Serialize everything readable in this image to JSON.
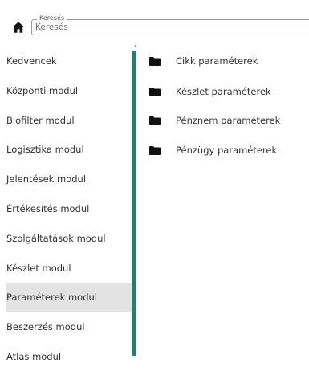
{
  "search": {
    "label": "Keresés",
    "placeholder": "Keresés"
  },
  "sidebar": {
    "items": [
      {
        "label": "Kedvencek",
        "selected": false
      },
      {
        "label": "Központi modul",
        "selected": false
      },
      {
        "label": "Biofilter modul",
        "selected": false
      },
      {
        "label": "Logisztika modul",
        "selected": false
      },
      {
        "label": "Jelentések modul",
        "selected": false
      },
      {
        "label": "Értékesítés modul",
        "selected": false
      },
      {
        "label": "Szolgáltatások modul",
        "selected": false
      },
      {
        "label": "Készlet modul",
        "selected": false
      },
      {
        "label": "Paraméterek modul",
        "selected": true
      },
      {
        "label": "Beszerzés modul",
        "selected": false
      },
      {
        "label": "Atlas modul",
        "selected": false
      }
    ]
  },
  "content": {
    "folders": [
      {
        "label": "Cikk paraméterek",
        "icon": "folder-icon"
      },
      {
        "label": "Készlet paraméterek",
        "icon": "folder-icon"
      },
      {
        "label": "Pénznem paraméterek",
        "icon": "folder-icon"
      },
      {
        "label": "Pénzügy paraméterek",
        "icon": "folder-icon"
      }
    ]
  },
  "colors": {
    "accent": "#0f8a6e",
    "selected_bg": "#e3e3e3"
  }
}
